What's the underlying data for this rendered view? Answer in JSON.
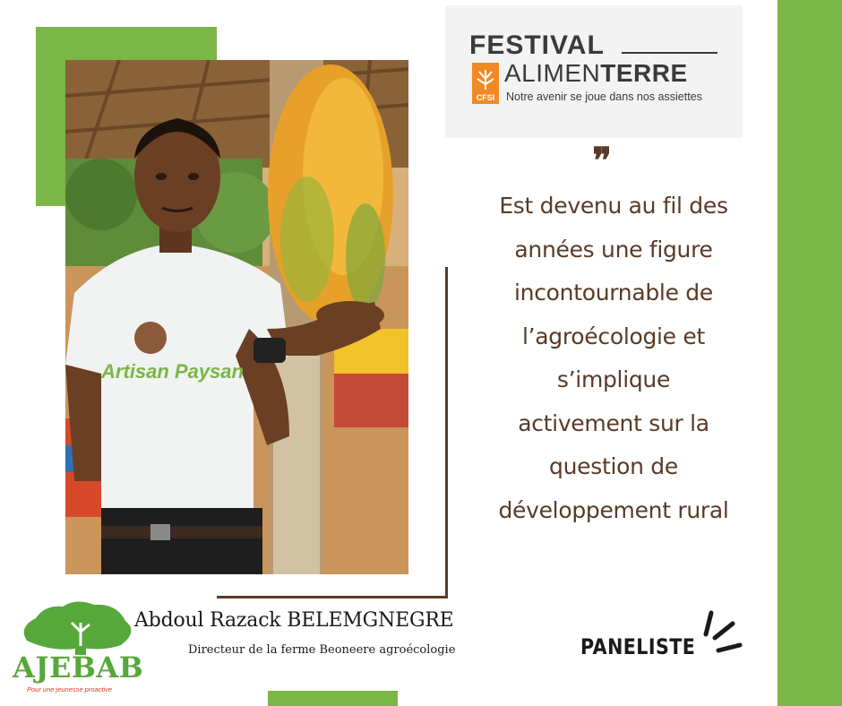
{
  "festival_logo": {
    "word1": "FESTIVAL",
    "word2_light": "ALIMEN",
    "word2_bold": "TERRE",
    "badge": "CFSI",
    "tagline": "Notre avenir se joue dans nos assiettes"
  },
  "quote": {
    "mark": "❞",
    "lines": [
      "Est devenu au fil des",
      "années une figure",
      "incontournable de",
      "l’agroécologie et",
      "s’implique",
      "activement sur la",
      "question de",
      "développement rural"
    ]
  },
  "speaker": {
    "name": "Abdoul Razack BELEMGNEGRE",
    "role": "Directeur de la ferme Beoneere agroécologie",
    "shirt_text": "Artisan Paysan"
  },
  "badge_label": "PANELISTE",
  "ajebab_logo": {
    "name": "AJEBAB",
    "tagline": "Pour une jeunesse proactive"
  },
  "colors": {
    "accent_green": "#7ab648",
    "text_brown": "#5a3a26",
    "logo_orange": "#f08a24"
  }
}
